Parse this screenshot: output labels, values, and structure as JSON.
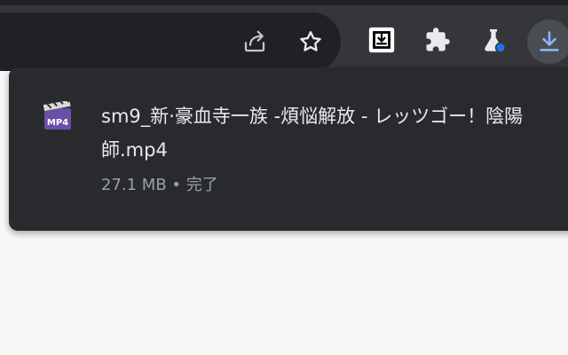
{
  "toolbar": {
    "icons": [
      "share-icon",
      "star-icon",
      "screenshot-extension-icon",
      "puzzle-extensions-icon",
      "flask-labs-icon",
      "download-icon"
    ]
  },
  "download_popup": {
    "file_name": "sm9_新·豪血寺一族 -煩悩解放 - レッツゴー！陰陽師.mp4",
    "file_type_badge": "MP4",
    "file_size": "27.1 MB",
    "separator": "•",
    "status": "完了"
  },
  "colors": {
    "toolbar_bg": "#35363a",
    "omnibox_bg": "#202124",
    "popup_bg": "#292a2d",
    "primary_text": "#e8eaed",
    "secondary_text": "#9aa0a6",
    "accent_blue": "#8ab4f8",
    "page_bg": "#f7f7f7"
  }
}
